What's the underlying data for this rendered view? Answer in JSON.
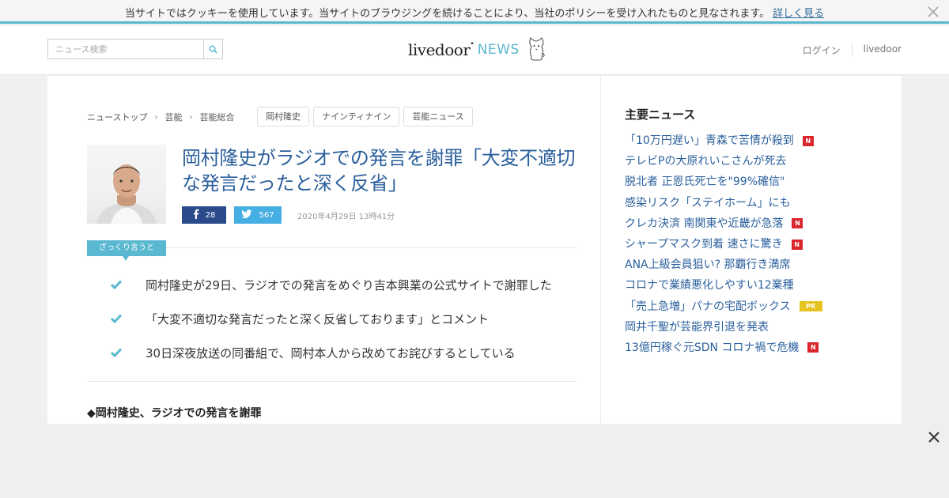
{
  "cookie_bar": {
    "message": "当サイトではクッキーを使用しています。当サイトのブラウジングを続けることにより、当社のポリシーを受け入れたものと見なされます。",
    "link_text": "詳しく見る",
    "close_icon": "close-icon"
  },
  "header": {
    "search": {
      "placeholder": "ニュース検索",
      "value": "",
      "button_icon": "search-icon"
    },
    "logo": {
      "main": "livedoor",
      "dot": "•",
      "news": "NEWS",
      "mascot_icon": "dog-mascot-icon"
    },
    "links": [
      "ログイン",
      "livedoor"
    ]
  },
  "breadcrumb": [
    "ニューストップ",
    "芸能",
    "芸能総合"
  ],
  "tags": [
    "岡村隆史",
    "ナインティナイン",
    "芸能ニュース"
  ],
  "article": {
    "title": "岡村隆史がラジオでの発言を謝罪「大変不適切な発言だったと深く反省」",
    "share": {
      "facebook_count": "28",
      "twitter_count": "567"
    },
    "date": "2020年4月29日 13時41分",
    "summary_label": "ざっくり言うと",
    "summary_items": [
      "岡村隆史が29日、ラジオでの発言をめぐり吉本興業の公式サイトで謝罪した",
      "「大変不適切な発言だったと深く反省しております」とコメント",
      "30日深夜放送の同番組で、岡村本人から改めてお詫びするとしている"
    ],
    "sub_heading": "◆岡村隆史、ラジオでの発言を謝罪"
  },
  "sidebar": {
    "title": "主要ニュース",
    "news": [
      {
        "text": "「10万円遅い」青森で苦情が殺到",
        "badge": "N"
      },
      {
        "text": "テレビPの大原れいこさんが死去",
        "badge": ""
      },
      {
        "text": "脱北者 正恩氏死亡を\"99%確信\"",
        "badge": ""
      },
      {
        "text": "感染リスク「ステイホーム」にも",
        "badge": ""
      },
      {
        "text": "クレカ決済 南関東や近畿が急落",
        "badge": "N"
      },
      {
        "text": "シャープマスク到着 速さに驚き",
        "badge": "N"
      },
      {
        "text": "ANA上級会員狙い? 那覇行き満席",
        "badge": ""
      },
      {
        "text": "コロナで業績悪化しやすい12業種",
        "badge": ""
      },
      {
        "text": "「売上急増」パナの宅配ボックス",
        "badge": "PR"
      },
      {
        "text": "岡井千聖が芸能界引退を発表",
        "badge": ""
      },
      {
        "text": "13億円稼ぐ元SDN コロナ禍で危機",
        "badge": "N"
      }
    ]
  },
  "colors": {
    "accent": "#5ab8d0",
    "link": "#2a5f9c",
    "facebook": "#2a4a8b",
    "twitter": "#45aee3",
    "badge_new": "#d9262c",
    "badge_pr": "#e6c31e"
  },
  "ad_strip": {
    "close_icon": "close-icon"
  }
}
